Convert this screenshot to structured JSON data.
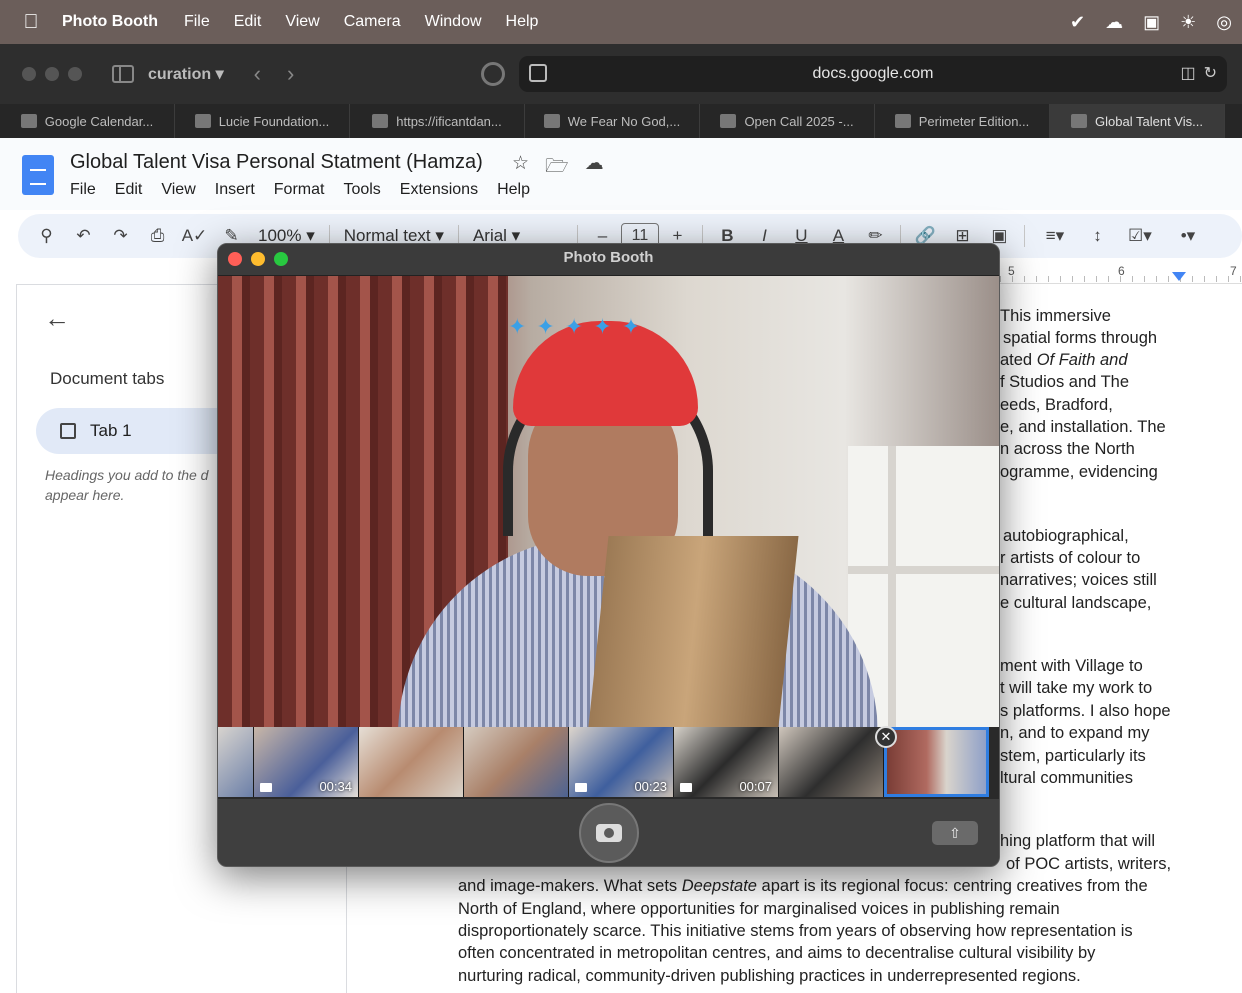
{
  "menubar": {
    "items": [
      "Photo Booth",
      "File",
      "Edit",
      "View",
      "Camera",
      "Window",
      "Help"
    ]
  },
  "browser": {
    "tab_group": "curation",
    "address": "docs.google.com",
    "tabs": [
      "Google Calendar...",
      "Lucie Foundation...",
      "https://ificantdan...",
      "We Fear No God,...",
      "Open Call 2025 -...",
      "Perimeter Edition...",
      "Global Talent Vis..."
    ]
  },
  "docs": {
    "title": "Global Talent Visa Personal Statment (Hamza)",
    "menu": [
      "File",
      "Edit",
      "View",
      "Insert",
      "Format",
      "Tools",
      "Extensions",
      "Help"
    ],
    "toolbar": {
      "zoom": "100%",
      "style": "Normal text",
      "font": "Arial",
      "font_size": "11"
    },
    "ruler": [
      "5",
      "6",
      "7"
    ],
    "sidebar": {
      "heading": "Document tabs",
      "tab": "Tab 1",
      "hint_line1": "Headings you add to the d",
      "hint_line2": "appear here."
    },
    "body_lines": [
      "This immersive",
      "spatial forms through",
      "ated ",
      "f Studios and The",
      "eeds, Bradford,",
      "e, and installation. The",
      "n across the North",
      "ogramme, evidencing",
      "autobiographical,",
      "r artists of colour to",
      "narratives; voices still",
      "e cultural landscape,",
      "ment with Village to",
      "t will take my work to",
      "s platforms. I also hope",
      "n, and to expand my",
      "stem, particularly its",
      "ltural communities",
      "hing platform that will",
      "of POC artists, writers,",
      "and image-makers. What sets ",
      "North of England, where opportunities for marginalised voices in publishing remain",
      "disproportionately scarce. This initiative stems from years of observing how representation is",
      "often concentrated in metropolitan centres, and aims to decentralise cultural visibility by",
      "nurturing radical, community-driven publishing practices in underrepresented regions."
    ],
    "italic_faith": "Of Faith and",
    "italic_deepstate": "Deepstate",
    "after_deepstate": " apart is its regional focus: centring creatives from the"
  },
  "photobooth": {
    "title": "Photo Booth",
    "thumbnails": [
      {
        "label": "00:34",
        "video": true
      },
      {
        "label": "",
        "video": false
      },
      {
        "label": "",
        "video": false
      },
      {
        "label": "00:23",
        "video": true
      },
      {
        "label": "00:07",
        "video": true
      },
      {
        "label": "",
        "video": false
      },
      {
        "label": "",
        "video": false
      }
    ]
  },
  "colors": {
    "menubar": "#6b5e5a",
    "accent_blue": "#2f7de1",
    "close": "#ff5f57",
    "minimize": "#febc2e",
    "zoom": "#28c840"
  }
}
